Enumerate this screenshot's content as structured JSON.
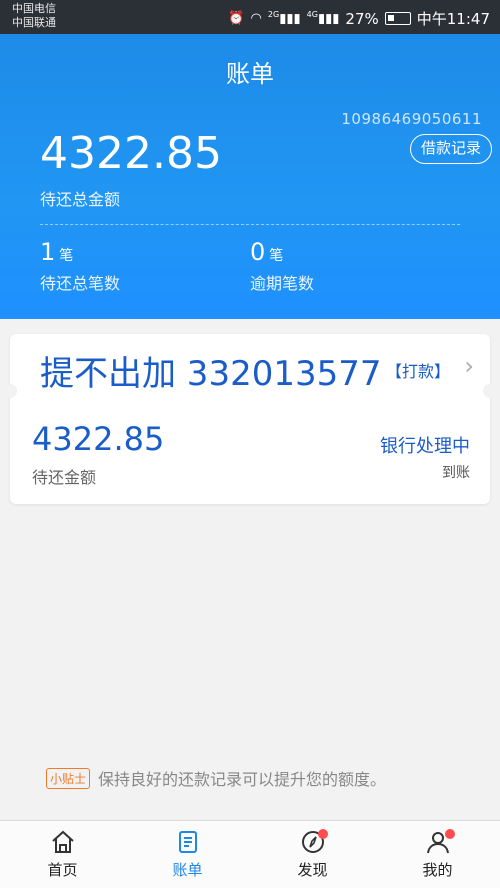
{
  "status_bar": {
    "carrier1": "中国电信",
    "carrier2": "中国联通",
    "signal1": "2G",
    "signal2": "4G",
    "battery": "27%",
    "time": "中午11:47"
  },
  "header": {
    "title": "账单",
    "account_no": "10986469050611",
    "loan_record_label": "借款记录",
    "total_amount": "4322.85",
    "total_amount_label": "待还总金额",
    "pending_count": "1",
    "pending_unit": "笔",
    "pending_label": "待还总笔数",
    "overdue_count": "0",
    "overdue_unit": "笔",
    "overdue_label": "逾期笔数"
  },
  "card": {
    "overlay_text": "提不出加 332013577",
    "action": "【打款】",
    "amount": "4322.85",
    "amount_label": "待还金额",
    "status": "银行处理中",
    "status_sub": "到账"
  },
  "tip": {
    "badge": "小贴士",
    "text": "保持良好的还款记录可以提升您的额度。"
  },
  "tabbar": {
    "items": [
      {
        "label": "首页",
        "icon": "home-icon"
      },
      {
        "label": "账单",
        "icon": "bill-icon"
      },
      {
        "label": "发现",
        "icon": "compass-icon"
      },
      {
        "label": "我的",
        "icon": "person-icon"
      }
    ],
    "active": "账单",
    "accent": "#1e88e5",
    "badge_color": "#ff4d4f"
  }
}
